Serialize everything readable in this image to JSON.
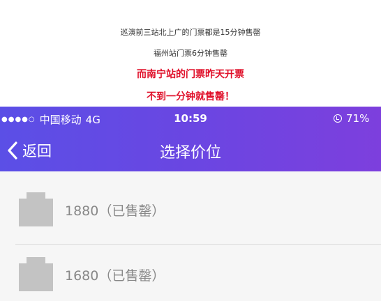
{
  "captions": [
    "巡演前三站北上广的门票都是15分钟售罄",
    "福州站门票6分钟售罄",
    "而南宁站的门票昨天开票",
    "不到一分钟就售罄！"
  ],
  "status_bar": {
    "signal": "●●●●○",
    "carrier": "中国移动",
    "network": "4G",
    "time": "10:59",
    "battery": "71%"
  },
  "nav": {
    "back_label": "返回",
    "title": "选择价位"
  },
  "price_options": [
    {
      "label": "1880（已售罄）"
    },
    {
      "label": "1680（已售罄）"
    }
  ],
  "colors": {
    "header_gradient_start": "#5b4fe6",
    "header_gradient_end": "#7d3fdd",
    "highlight_text": "#e0102a"
  }
}
